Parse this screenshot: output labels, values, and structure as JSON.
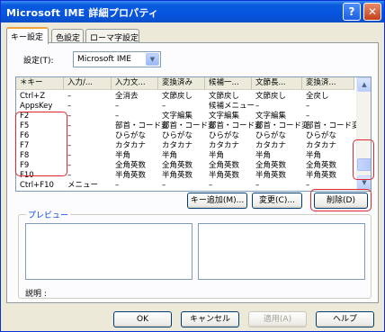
{
  "window": {
    "title": "Microsoft IME 詳細プロパティ",
    "help_glyph": "?",
    "close_glyph": "✕"
  },
  "tabs": [
    {
      "label": "キー設定",
      "active": true
    },
    {
      "label": "色設定",
      "active": false
    },
    {
      "label": "ローマ字設定",
      "active": false
    }
  ],
  "settings": {
    "label": "設定(T):",
    "value": "Microsoft IME"
  },
  "keylist": {
    "columns": [
      "＊キー",
      "入力/...",
      "入力文...",
      "変換済み",
      "候補一...",
      "文節長...",
      "変換済..."
    ],
    "rows": [
      [
        "Ctrl+Z",
        "–",
        "全消去",
        "文節戻し",
        "文節戻し",
        "文節戻し",
        "全戻し"
      ],
      [
        "AppsKey",
        "–",
        "–",
        "–",
        "候補メニュー",
        "–",
        "–"
      ],
      [
        "F2",
        "–",
        "–",
        "文字編集",
        "文字編集",
        "文字編集",
        "–"
      ],
      [
        "F5",
        "–",
        "部首・コード変",
        "部首・コード変",
        "部首・コード変",
        "部首・コード変",
        "部首・コード変"
      ],
      [
        "F6",
        "–",
        "ひらがな",
        "ひらがな",
        "ひらがな",
        "ひらがな",
        "ひらがな"
      ],
      [
        "F7",
        "–",
        "カタカナ",
        "カタカナ",
        "カタカナ",
        "カタカナ",
        "カタカナ"
      ],
      [
        "F8",
        "–",
        "半角",
        "半角",
        "半角",
        "半角",
        "半角"
      ],
      [
        "F9",
        "–",
        "全角英数",
        "全角英数",
        "全角英数",
        "全角英数",
        "全角英数"
      ],
      [
        "F10",
        "–",
        "半角英数",
        "半角英数",
        "半角英数",
        "半角英数",
        "半角英数"
      ],
      [
        "Ctrl+F10",
        "メニュー",
        "–",
        "–",
        "–",
        "–",
        "–"
      ]
    ]
  },
  "buttons": {
    "add_key": "キー追加(M)...",
    "change": "変更(C)...",
    "delete": "削除(D)",
    "ok": "OK",
    "cancel": "キャンセル",
    "apply": "適用(A)",
    "help": "ヘルプ"
  },
  "preview": {
    "title": "プレビュー",
    "description_label": "説明 :"
  },
  "icons": {
    "scroll_up": "▲",
    "scroll_down": "▼",
    "combo_arrow": "▼"
  },
  "colors": {
    "title_bar": "#0a5ddd",
    "annotation": "#e0262f",
    "group_title": "#0046d5"
  }
}
